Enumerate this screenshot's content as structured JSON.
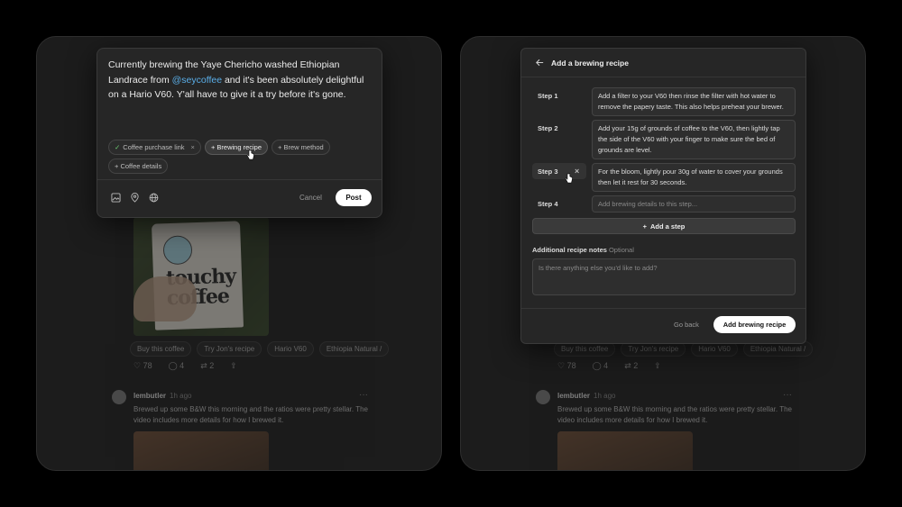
{
  "feed": {
    "chips": [
      "Buy this coffee",
      "Try Jon's recipe",
      "Hario V60",
      "Ethiopia Natural /"
    ],
    "likes": "78",
    "comments": "4",
    "reposts": "2",
    "photo_brand": "touchy coffee",
    "post2_user": "lembutler",
    "post2_time": "1h ago",
    "post2_text": "Brewed up some B&W this morning and the ratios were pretty stellar. The video includes more details for how I brewed it."
  },
  "composer": {
    "text_before": "Currently brewing the Yaye Chericho washed Ethiopian Landrace from ",
    "mention": "@seycoffee",
    "text_after": " and it's been absolutely delightful on a Hario V60. Y'all have to give it a try before it's gone.",
    "tags": [
      {
        "label": "Coffee purchase link",
        "state": "added"
      },
      {
        "label": "+ Brewing recipe",
        "state": "hover"
      },
      {
        "label": "+ Brew method",
        "state": "default"
      },
      {
        "label": "+ Coffee details",
        "state": "default"
      }
    ],
    "cancel_label": "Cancel",
    "post_label": "Post"
  },
  "recipe": {
    "title": "Add a brewing recipe",
    "steps": [
      {
        "label": "Step 1",
        "text": "Add a filter to your V60 then rinse the filter with hot water to remove the papery taste. This also helps preheat your brewer."
      },
      {
        "label": "Step 2",
        "text": "Add your 15g of grounds of coffee to the V60, then lightly tap the side of the V60 with your finger to make sure the bed of grounds are level."
      },
      {
        "label": "Step 3",
        "text": "For the bloom, lightly pour 30g of water to cover your grounds then let it rest for 30 seconds."
      },
      {
        "label": "Step 4",
        "placeholder": "Add brewing details to this step..."
      }
    ],
    "add_step_label": "Add a step",
    "notes_label": "Additional recipe notes",
    "notes_optional": "Optional",
    "notes_placeholder": "Is there anything else you'd like to add?",
    "go_back_label": "Go back",
    "submit_label": "Add brewing recipe"
  },
  "colors": {
    "accent_link": "#5aaee8",
    "check": "#6fcf73",
    "background": "#000000"
  }
}
